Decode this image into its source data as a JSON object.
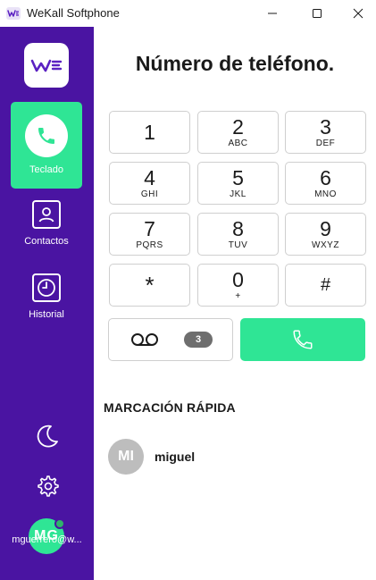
{
  "window": {
    "title": "WeKall Softphone"
  },
  "sidebar": {
    "logo": "WE",
    "items": [
      {
        "label": "Teclado",
        "icon": "phone-icon",
        "active": true
      },
      {
        "label": "Contactos",
        "icon": "contact-card-icon",
        "active": false
      },
      {
        "label": "Historial",
        "icon": "clock-icon",
        "active": false
      }
    ],
    "theme_icon": "moon-icon",
    "settings_icon": "gear-icon",
    "user": {
      "initials": "MG",
      "email": "mguerrero@w..."
    }
  },
  "dialer": {
    "placeholder": "Número de teléfono.",
    "keys": [
      {
        "digit": "1",
        "letters": ""
      },
      {
        "digit": "2",
        "letters": "ABC"
      },
      {
        "digit": "3",
        "letters": "DEF"
      },
      {
        "digit": "4",
        "letters": "GHI"
      },
      {
        "digit": "5",
        "letters": "JKL"
      },
      {
        "digit": "6",
        "letters": "MNO"
      },
      {
        "digit": "7",
        "letters": "PQRS"
      },
      {
        "digit": "8",
        "letters": "TUV"
      },
      {
        "digit": "9",
        "letters": "WXYZ"
      },
      {
        "digit": "*",
        "letters": ""
      },
      {
        "digit": "0",
        "letters": "+"
      },
      {
        "digit": "#",
        "letters": ""
      }
    ],
    "voicemail_count": "3"
  },
  "speed_dial": {
    "title": "MARCACIÓN RÁPIDA",
    "contacts": [
      {
        "initials": "MI",
        "name": "miguel"
      }
    ]
  },
  "colors": {
    "sidebar": "#4a14a2",
    "accent": "#2fe595",
    "badge": "#6e6e6e"
  }
}
